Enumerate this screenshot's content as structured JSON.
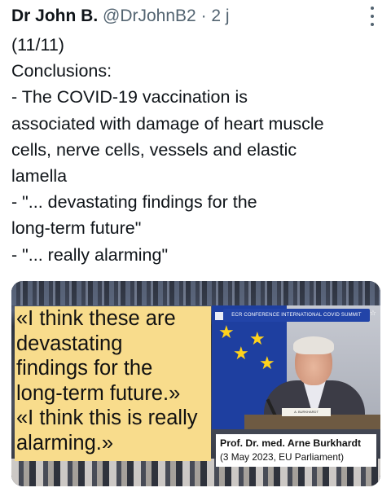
{
  "header": {
    "name": "Dr John B.",
    "handle": "@DrJohnB2",
    "separator": "·",
    "time": "2 j"
  },
  "tweet": {
    "lines": [
      "(11/11)",
      "Conclusions:",
      "- The COVID-19 vaccination is",
      "associated with damage of heart muscle",
      "cells, nerve cells, vessels and elastic",
      "lamella",
      "- \"... devastating findings for the",
      "long-term future\"",
      "- \"... really alarming\""
    ]
  },
  "media": {
    "quote_lines": [
      "«I think these are",
      "devastating",
      "findings for the",
      "long-term future.»",
      "«I think this is really",
      "alarming.»"
    ],
    "banner_text": "ECR CONFERENCE INTERNATIONAL COVID SUMMIT",
    "nameplate_text": "A. BURKHARDT",
    "caption_name": "Prof. Dr. med. Arne Burkhardt",
    "caption_detail": "(3 May 2023, EU Parliament)"
  },
  "icons": {
    "more": "more-vertical-icon",
    "star": "star-icon"
  },
  "colors": {
    "text_primary": "#0f1419",
    "text_secondary": "#536471",
    "quote_background": "#f8dc8c",
    "eu_blue": "#1e3fa0",
    "eu_star": "#ffd21c"
  }
}
